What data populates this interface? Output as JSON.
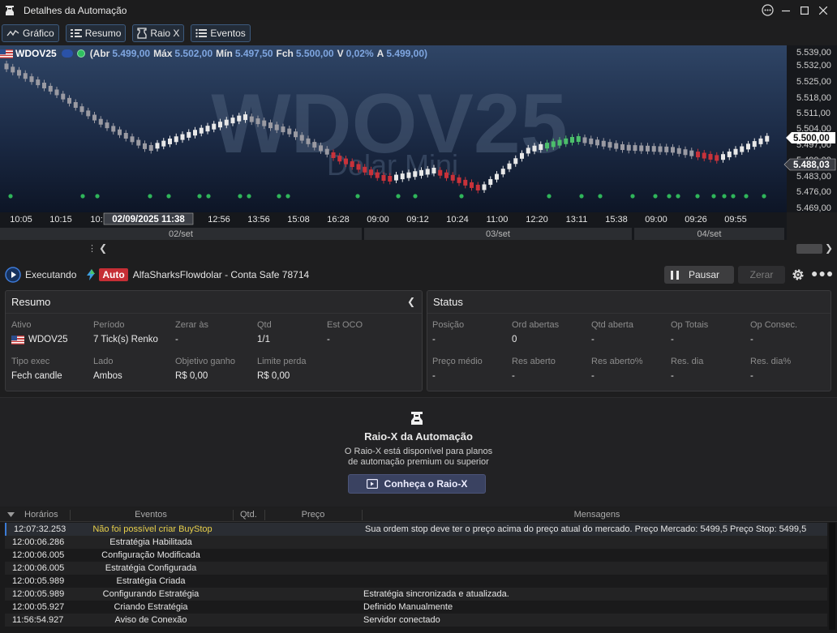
{
  "window": {
    "title": "Detalhes da Automação",
    "buttons": [
      "help",
      "minimize",
      "maximize",
      "close"
    ]
  },
  "tabs": [
    {
      "label": "Gráfico",
      "icon": "line-chart-icon"
    },
    {
      "label": "Resumo",
      "icon": "list-icon"
    },
    {
      "label": "Raio X",
      "icon": "xray-icon"
    },
    {
      "label": "Eventos",
      "icon": "events-list-icon"
    }
  ],
  "chart": {
    "symbol": "WDOV25",
    "watermark": "WDOV25",
    "watermark_sub": "Dolar Mini",
    "ohlc": {
      "open_label": "(Abr",
      "open": "5.499,00",
      "high_label": "Máx",
      "high": "5.502,00",
      "low_label": "Mín",
      "low": "5.497,50",
      "close_label": "Fch",
      "close": "5.500,00",
      "change_label": "V",
      "change": "0,02%",
      "ask_label": "A",
      "ask": "5.499,00)"
    },
    "price_ticks": [
      "5.539,00",
      "5.532,00",
      "5.525,00",
      "5.518,00",
      "5.511,00",
      "5.504,00",
      "5.497,00",
      "5.490,00",
      "5.483,00",
      "5.476,00",
      "5.469,00"
    ],
    "last_price_label": "5.500,00",
    "cursor_price_label": "5.488,03",
    "time_ticks": [
      "10:05",
      "10:15",
      "10:",
      "12:56",
      "13:56",
      "15:08",
      "16:28",
      "09:00",
      "09:12",
      "10:24",
      "11:00",
      "12:20",
      "13:11",
      "15:38",
      "09:00",
      "09:26",
      "09:55"
    ],
    "cursor_time_label": "02/09/2025 11:38",
    "sessions": [
      "02/set",
      "03/set",
      "04/set"
    ],
    "colors": {
      "bull": "#e8e8e8",
      "bear": "#c8323a",
      "bull_hl": "#4cbf6b",
      "signal": "#2fb55a"
    },
    "chart_data": {
      "type": "line",
      "title": "WDOV25",
      "xlabel": "",
      "ylabel": "",
      "ylim": [
        5469,
        5540
      ],
      "x": [
        "10:05",
        "10:15",
        "10:",
        "12:56",
        "13:56",
        "15:08",
        "16:28",
        "09:00",
        "09:12",
        "10:24",
        "11:00",
        "12:20",
        "13:11",
        "15:38",
        "09:00",
        "09:26",
        "09:55"
      ],
      "series": [
        {
          "name": "",
          "values": [
            5533.0,
            5522.0,
            5507.5,
            5495.5,
            5503.0,
            5510.0,
            5503.0,
            5491.0,
            5481.5,
            5485.5,
            5477.0,
            5495.0,
            5500.0,
            5496.0,
            5495.0,
            5491.0,
            5500.0
          ]
        }
      ]
    }
  },
  "run": {
    "status": "Executando",
    "mode_badge": "Auto",
    "strategy": "AlfaSharksFlowdolar - Conta Safe 78714",
    "pause_label": "Pausar",
    "zero_label": "Zerar"
  },
  "resumo": {
    "title": "Resumo",
    "fields": [
      {
        "label": "Ativo",
        "value": "WDOV25"
      },
      {
        "label": "Período",
        "value": "7 Tick(s) Renko"
      },
      {
        "label": "Zerar às",
        "value": "-"
      },
      {
        "label": "Qtd",
        "value": "1/1"
      },
      {
        "label": "Est OCO",
        "value": "-"
      },
      {
        "label": "Tipo exec",
        "value": "Fech candle"
      },
      {
        "label": "Lado",
        "value": "Ambos"
      },
      {
        "label": "Objetivo ganho",
        "value": "R$ 0,00"
      },
      {
        "label": "Limite perda",
        "value": "R$ 0,00"
      }
    ]
  },
  "status": {
    "title": "Status",
    "fields": [
      {
        "label": "Posição",
        "value": "-"
      },
      {
        "label": "Ord abertas",
        "value": "0"
      },
      {
        "label": "Qtd aberta",
        "value": "-"
      },
      {
        "label": "Op Totais",
        "value": "-"
      },
      {
        "label": "Op Consec.",
        "value": "-"
      },
      {
        "label": "Preço médio",
        "value": "-"
      },
      {
        "label": "Res aberto",
        "value": "-"
      },
      {
        "label": "Res aberto%",
        "value": "-"
      },
      {
        "label": "Res. dia",
        "value": "-"
      },
      {
        "label": "Res. dia%",
        "value": "-"
      }
    ]
  },
  "raiox": {
    "title": "Raio-X da Automação",
    "desc_line1": "O Raio-X está disponível para planos",
    "desc_line2": "de automação premium ou superior",
    "button": "Conheça o Raio-X"
  },
  "events": {
    "columns": [
      "Horários",
      "Eventos",
      "Qtd.",
      "Preço",
      "Mensagens"
    ],
    "rows": [
      {
        "time": "12:07:32.253",
        "event": "Não foi possível criar BuyStop",
        "qty": "",
        "price": "",
        "msg": "Sua ordem stop deve ter o preço acima do preço atual do mercado. Preço Mercado: 5499,5 Preço Stop: 5499,5"
      },
      {
        "time": "12:00:06.286",
        "event": "Estratégia Habilitada",
        "qty": "",
        "price": "",
        "msg": ""
      },
      {
        "time": "12:00:06.005",
        "event": "Configuração Modificada",
        "qty": "",
        "price": "",
        "msg": ""
      },
      {
        "time": "12:00:06.005",
        "event": "Estratégia Configurada",
        "qty": "",
        "price": "",
        "msg": ""
      },
      {
        "time": "12:00:05.989",
        "event": "Estratégia Criada",
        "qty": "",
        "price": "",
        "msg": ""
      },
      {
        "time": "12:00:05.989",
        "event": "Configurando Estratégia",
        "qty": "",
        "price": "",
        "msg": "Estratégia sincronizada e atualizada."
      },
      {
        "time": "12:00:05.927",
        "event": "Criando Estratégia",
        "qty": "",
        "price": "",
        "msg": "Definido Manualmente"
      },
      {
        "time": "11:56:54.927",
        "event": "Aviso de Conexão",
        "qty": "",
        "price": "",
        "msg": "Servidor conectado"
      }
    ]
  }
}
